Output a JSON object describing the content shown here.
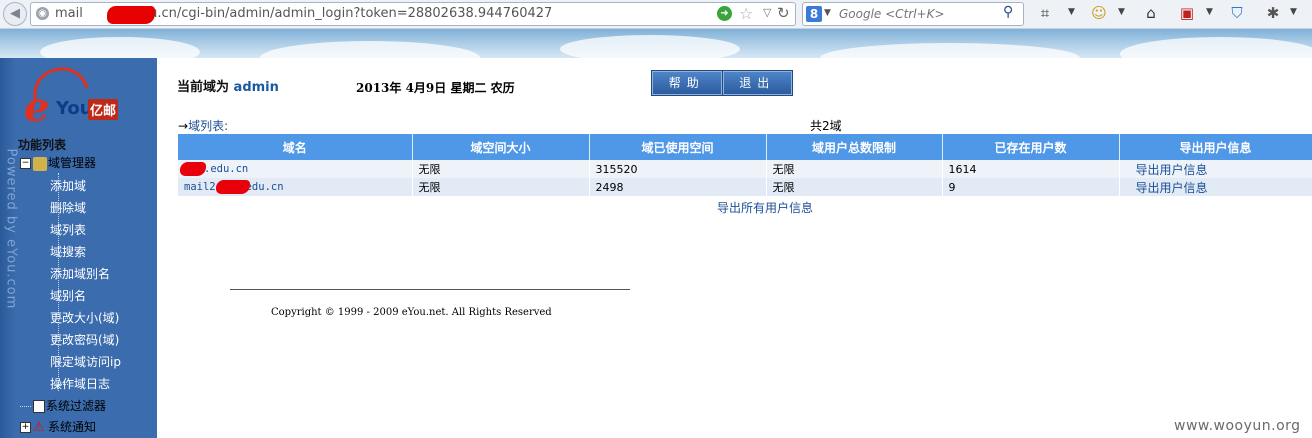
{
  "browser": {
    "url": "mail.edu.cn/cgi-bin/admin/admin_login?token=28802638.944760427",
    "url_prefix": "mail",
    "url_suffix": "edu.cn/cgi-bin/admin/admin_login?token=28802638.944760427",
    "search_placeholder": "Google <Ctrl+K>",
    "search_engine_letter": "8"
  },
  "sidebar": {
    "powered_by": "Powered by eYou.com",
    "logo_e": "e",
    "logo_you": "You",
    "logo_cn": "亿邮",
    "menu_title": "功能列表",
    "domain_manager": "域管理器",
    "items": [
      {
        "label": "添加域"
      },
      {
        "label": "删除域"
      },
      {
        "label": "域列表"
      },
      {
        "label": "域搜索"
      },
      {
        "label": "添加域别名"
      },
      {
        "label": "域别名"
      },
      {
        "label": "更改大小(域)"
      },
      {
        "label": "更改密码(域)"
      },
      {
        "label": "限定域访问ip"
      },
      {
        "label": "操作域日志"
      }
    ],
    "system_filter": "系统过滤器",
    "system_notice": "系统通知"
  },
  "header": {
    "current_domain_label": "当前域为",
    "current_domain_value": "admin",
    "date": "2013年  4月9日  星期二  农历",
    "help_button": "帮助",
    "exit_button": "退出"
  },
  "domain_list": {
    "title_arrow": "→",
    "title": "域列表:",
    "count": "共2域",
    "columns": [
      "域名",
      "域空间大小",
      "域已使用空间",
      "域用户总数限制",
      "已存在用户数",
      "导出用户信息"
    ],
    "rows": [
      {
        "domain": ".edu.cn",
        "size": "无限",
        "used": "315520",
        "user_limit": "无限",
        "users": "1614",
        "export": "导出用户信息"
      },
      {
        "domain_prefix": "mail2",
        "domain": "edu.cn",
        "size": "无限",
        "used": "2498",
        "user_limit": "无限",
        "users": "9",
        "export": "导出用户信息"
      }
    ],
    "export_all": "导出所有用户信息"
  },
  "footer": {
    "copyright": "Copyright © 1999 - 2009 eYou.net. All Rights Reserved"
  },
  "watermark": "www.wooyun.org"
}
